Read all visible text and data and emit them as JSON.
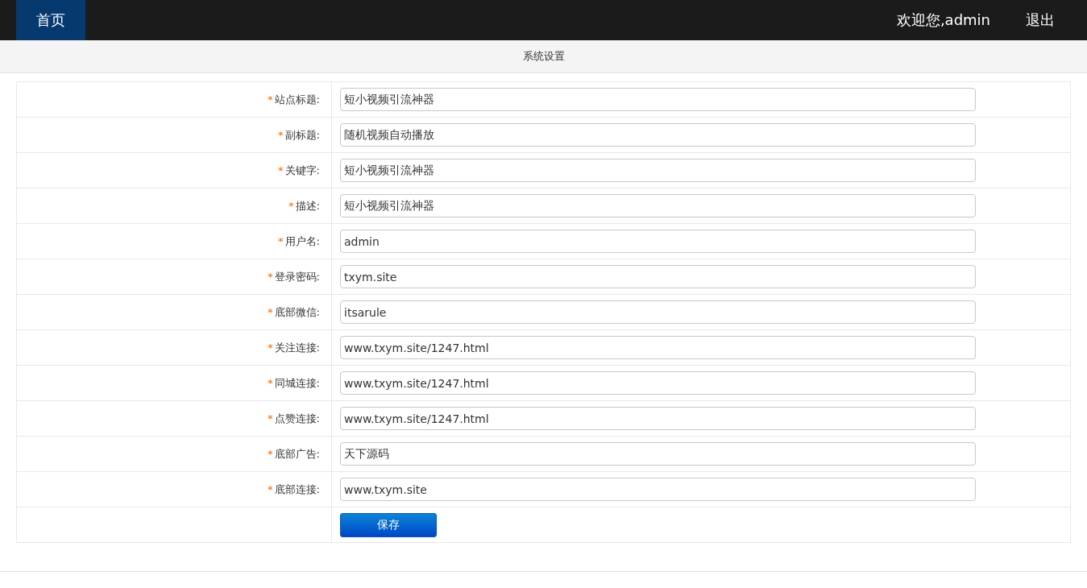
{
  "nav": {
    "items": [
      {
        "label": "首页",
        "selected": true
      }
    ],
    "welcome": "欢迎您,admin",
    "logout": "退出"
  },
  "page_title": "系统设置",
  "fields": [
    {
      "mark": "*",
      "label": "站点标题:",
      "value": "短小视频引流神器"
    },
    {
      "mark": "*",
      "label": "副标题:",
      "value": "随机视频自动播放"
    },
    {
      "mark": "*",
      "label": "关键字:",
      "value": "短小视频引流神器"
    },
    {
      "mark": "*",
      "label": "描述:",
      "value": "短小视频引流神器"
    },
    {
      "mark": "*",
      "label": "用户名:",
      "value": "admin"
    },
    {
      "mark": "*",
      "label": "登录密码:",
      "value": "txym.site"
    },
    {
      "mark": "*",
      "label": "底部微信:",
      "value": "itsarule"
    },
    {
      "mark": "*",
      "label": "关注连接:",
      "value": "www.txym.site/1247.html"
    },
    {
      "mark": "*",
      "label": "同城连接:",
      "value": "www.txym.site/1247.html"
    },
    {
      "mark": "*",
      "label": "点赞连接:",
      "value": "www.txym.site/1247.html"
    },
    {
      "mark": "*",
      "label": "底部广告:",
      "value": "天下源码"
    },
    {
      "mark": "*",
      "label": "底部连接:",
      "value": "www.txym.site"
    }
  ],
  "save_button": "保存"
}
